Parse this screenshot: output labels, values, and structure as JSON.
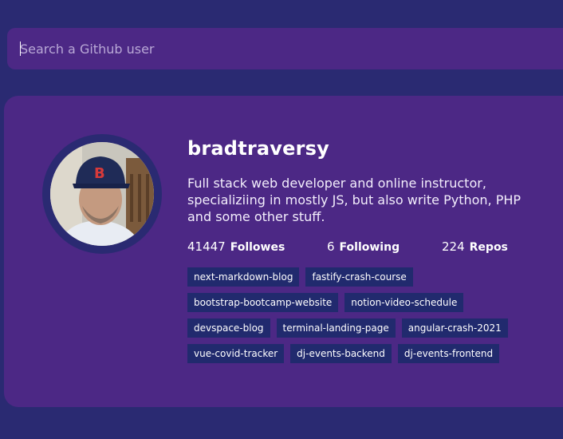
{
  "search": {
    "placeholder": "Search a Github user",
    "value": ""
  },
  "profile": {
    "username": "bradtraversy",
    "bio": "Full stack web developer and online instructor, specializiing in mostly JS, but also write Python, PHP and some other stuff.",
    "stats": {
      "followers_count": "41447",
      "followers_label": "Followes",
      "following_count": "6",
      "following_label": "Following",
      "repos_count": "224",
      "repos_label": "Repos"
    },
    "repos": [
      "next-markdown-blog",
      "fastify-crash-course",
      "bootstrap-bootcamp-website",
      "notion-video-schedule",
      "devspace-blog",
      "terminal-landing-page",
      "angular-crash-2021",
      "vue-covid-tracker",
      "dj-events-backend",
      "dj-events-frontend"
    ]
  },
  "colors": {
    "background": "#2a2a72",
    "card": "#4c2885",
    "repo_tag": "#212a6e",
    "text": "#ffffff"
  }
}
